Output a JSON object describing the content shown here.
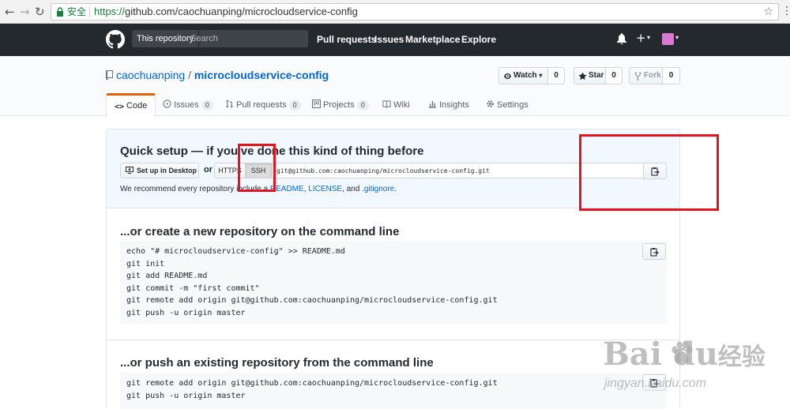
{
  "browser": {
    "back_icon": "arrow-left-icon",
    "forward_icon": "arrow-right-icon",
    "reload_icon": "reload-icon",
    "secure_label": "安全",
    "url_scheme": "https://",
    "url_rest": "github.com/caochuanping/microcloudservice-config",
    "bookmark_icon": "star-outline-icon"
  },
  "header": {
    "scope_label": "This repository",
    "search_placeholder": "Search",
    "links": [
      "Pull requests",
      "Issues",
      "Marketplace",
      "Explore"
    ],
    "plus_label": "+",
    "caret": "▾"
  },
  "repo": {
    "owner": "caochuanping",
    "separator": "/",
    "name": "microcloudservice-config",
    "watch_label": "Watch",
    "watch_caret": "▾",
    "watch_count": "0",
    "star_label": "Star",
    "star_count": "0",
    "fork_label": "Fork",
    "fork_count": "0"
  },
  "tabs": {
    "code": "Code",
    "issues": "Issues",
    "issues_count": "0",
    "pulls": "Pull requests",
    "pulls_count": "0",
    "projects": "Projects",
    "projects_count": "0",
    "wiki": "Wiki",
    "insights": "Insights",
    "settings": "Settings"
  },
  "quick_setup": {
    "title": "Quick setup — if you've done this kind of thing before",
    "desktop_button": "Set up in Desktop",
    "or": "or",
    "https_label": "HTTPS",
    "ssh_label": "SSH",
    "clone_url": "git@github.com:caochuanping/microcloudservice-config.git",
    "recommend_prefix": "We recommend every repository include a ",
    "readme": "README",
    "comma": ", ",
    "license": "LICENSE",
    "and": ", and ",
    "gitignore": ".gitignore",
    "period": "."
  },
  "new_repo": {
    "title": "...or create a new repository on the command line",
    "lines": [
      "echo \"# microcloudservice-config\" >> README.md",
      "git init",
      "git add README.md",
      "git commit -m \"first commit\"",
      "git remote add origin git@github.com:caochuanping/microcloudservice-config.git",
      "git push -u origin master"
    ]
  },
  "push_existing": {
    "title": "...or push an existing repository from the command line",
    "lines": [
      "git remote add origin git@github.com:caochuanping/microcloudservice-config.git",
      "git push -u origin master"
    ]
  },
  "watermark": {
    "brand": "Bai  du",
    "brand_cn": "经验",
    "site": "jingyan.baidu.com"
  },
  "colors": {
    "annotation": "#e2141f",
    "link": "#0366d6",
    "header_bg": "#24292e",
    "quick_setup_bg": "#f1f8ff"
  }
}
